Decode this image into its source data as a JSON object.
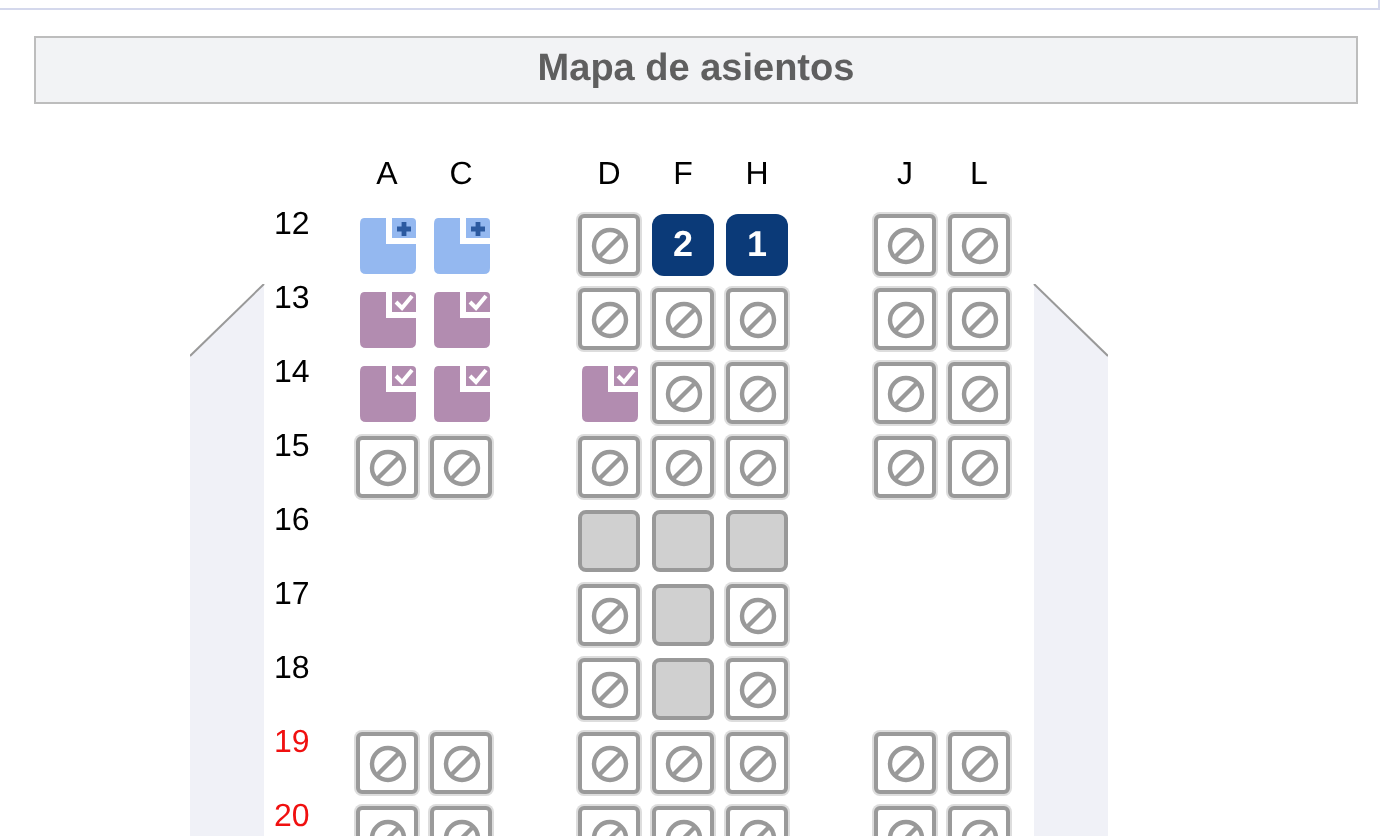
{
  "title": "Mapa de asientos",
  "columns": [
    "A",
    "C",
    null,
    "D",
    "F",
    "H",
    null,
    "J",
    "L"
  ],
  "rows": [
    {
      "number": "12",
      "exit": false,
      "seats": [
        {
          "kind": "available"
        },
        {
          "kind": "available"
        },
        {
          "kind": "gap"
        },
        {
          "kind": "blocked"
        },
        {
          "kind": "selected",
          "label": "2"
        },
        {
          "kind": "selected",
          "label": "1"
        },
        {
          "kind": "gap"
        },
        {
          "kind": "blocked"
        },
        {
          "kind": "blocked"
        }
      ]
    },
    {
      "number": "13",
      "exit": false,
      "seats": [
        {
          "kind": "occupied"
        },
        {
          "kind": "occupied"
        },
        {
          "kind": "gap"
        },
        {
          "kind": "blocked"
        },
        {
          "kind": "blocked"
        },
        {
          "kind": "blocked"
        },
        {
          "kind": "gap"
        },
        {
          "kind": "blocked"
        },
        {
          "kind": "blocked"
        }
      ]
    },
    {
      "number": "14",
      "exit": false,
      "seats": [
        {
          "kind": "occupied"
        },
        {
          "kind": "occupied"
        },
        {
          "kind": "gap"
        },
        {
          "kind": "occupied"
        },
        {
          "kind": "blocked"
        },
        {
          "kind": "blocked"
        },
        {
          "kind": "gap"
        },
        {
          "kind": "blocked"
        },
        {
          "kind": "blocked"
        }
      ]
    },
    {
      "number": "15",
      "exit": false,
      "seats": [
        {
          "kind": "blocked"
        },
        {
          "kind": "blocked"
        },
        {
          "kind": "gap"
        },
        {
          "kind": "blocked"
        },
        {
          "kind": "blocked"
        },
        {
          "kind": "blocked"
        },
        {
          "kind": "gap"
        },
        {
          "kind": "blocked"
        },
        {
          "kind": "blocked"
        }
      ]
    },
    {
      "number": "16",
      "exit": false,
      "seats": [
        {
          "kind": "gap"
        },
        {
          "kind": "gap"
        },
        {
          "kind": "gap"
        },
        {
          "kind": "unavailable"
        },
        {
          "kind": "unavailable"
        },
        {
          "kind": "unavailable"
        },
        {
          "kind": "gap"
        },
        {
          "kind": "gap"
        },
        {
          "kind": "gap"
        }
      ]
    },
    {
      "number": "17",
      "exit": false,
      "seats": [
        {
          "kind": "gap"
        },
        {
          "kind": "gap"
        },
        {
          "kind": "gap"
        },
        {
          "kind": "blocked"
        },
        {
          "kind": "unavailable"
        },
        {
          "kind": "blocked"
        },
        {
          "kind": "gap"
        },
        {
          "kind": "gap"
        },
        {
          "kind": "gap"
        }
      ]
    },
    {
      "number": "18",
      "exit": false,
      "seats": [
        {
          "kind": "gap"
        },
        {
          "kind": "gap"
        },
        {
          "kind": "gap"
        },
        {
          "kind": "blocked"
        },
        {
          "kind": "unavailable"
        },
        {
          "kind": "blocked"
        },
        {
          "kind": "gap"
        },
        {
          "kind": "gap"
        },
        {
          "kind": "gap"
        }
      ]
    },
    {
      "number": "19",
      "exit": true,
      "seats": [
        {
          "kind": "blocked"
        },
        {
          "kind": "blocked"
        },
        {
          "kind": "gap"
        },
        {
          "kind": "blocked"
        },
        {
          "kind": "blocked"
        },
        {
          "kind": "blocked"
        },
        {
          "kind": "gap"
        },
        {
          "kind": "blocked"
        },
        {
          "kind": "blocked"
        }
      ]
    },
    {
      "number": "20",
      "exit": true,
      "seats": [
        {
          "kind": "blocked"
        },
        {
          "kind": "blocked"
        },
        {
          "kind": "gap"
        },
        {
          "kind": "blocked"
        },
        {
          "kind": "blocked"
        },
        {
          "kind": "blocked"
        },
        {
          "kind": "gap"
        },
        {
          "kind": "blocked"
        },
        {
          "kind": "blocked"
        }
      ]
    }
  ]
}
